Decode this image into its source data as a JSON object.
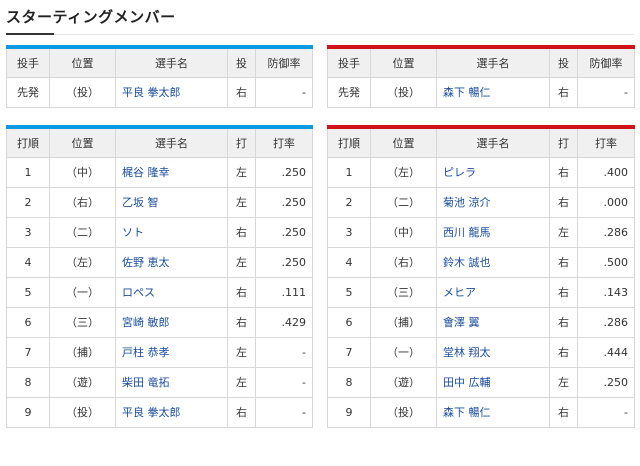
{
  "title": "スターティングメンバー",
  "colors": {
    "home_accent": "#0a9ae0",
    "away_accent": "#d0121b",
    "link": "#1a4d9e"
  },
  "pitcher_headers": [
    "投手",
    "位置",
    "選手名",
    "投",
    "防御率"
  ],
  "lineup_headers": [
    "打順",
    "位置",
    "選手名",
    "打",
    "打率"
  ],
  "home": {
    "pitcher": {
      "role": "先発",
      "pos": "（投）",
      "name": "平良 拳太郎",
      "throws": "右",
      "era": "-"
    },
    "lineup": [
      {
        "order": "1",
        "pos": "（中）",
        "name": "梶谷 隆幸",
        "bats": "左",
        "avg": ".250"
      },
      {
        "order": "2",
        "pos": "（右）",
        "name": "乙坂 智",
        "bats": "左",
        "avg": ".250"
      },
      {
        "order": "3",
        "pos": "（二）",
        "name": "ソト",
        "bats": "右",
        "avg": ".250"
      },
      {
        "order": "4",
        "pos": "（左）",
        "name": "佐野 恵太",
        "bats": "左",
        "avg": ".250"
      },
      {
        "order": "5",
        "pos": "（一）",
        "name": "ロペス",
        "bats": "右",
        "avg": ".111"
      },
      {
        "order": "6",
        "pos": "（三）",
        "name": "宮崎 敏郎",
        "bats": "右",
        "avg": ".429"
      },
      {
        "order": "7",
        "pos": "（捕）",
        "name": "戸柱 恭孝",
        "bats": "左",
        "avg": "-"
      },
      {
        "order": "8",
        "pos": "（遊）",
        "name": "柴田 竜拓",
        "bats": "左",
        "avg": "-"
      },
      {
        "order": "9",
        "pos": "（投）",
        "name": "平良 拳太郎",
        "bats": "右",
        "avg": "-"
      }
    ]
  },
  "away": {
    "pitcher": {
      "role": "先発",
      "pos": "（投）",
      "name": "森下 暢仁",
      "throws": "右",
      "era": "-"
    },
    "lineup": [
      {
        "order": "1",
        "pos": "（左）",
        "name": "ピレラ",
        "bats": "右",
        "avg": ".400"
      },
      {
        "order": "2",
        "pos": "（二）",
        "name": "菊池 涼介",
        "bats": "右",
        "avg": ".000"
      },
      {
        "order": "3",
        "pos": "（中）",
        "name": "西川 龍馬",
        "bats": "左",
        "avg": ".286"
      },
      {
        "order": "4",
        "pos": "（右）",
        "name": "鈴木 誠也",
        "bats": "右",
        "avg": ".500"
      },
      {
        "order": "5",
        "pos": "（三）",
        "name": "メヒア",
        "bats": "右",
        "avg": ".143"
      },
      {
        "order": "6",
        "pos": "（捕）",
        "name": "會澤 翼",
        "bats": "右",
        "avg": ".286"
      },
      {
        "order": "7",
        "pos": "（一）",
        "name": "堂林 翔太",
        "bats": "右",
        "avg": ".444"
      },
      {
        "order": "8",
        "pos": "（遊）",
        "name": "田中 広輔",
        "bats": "左",
        "avg": ".250"
      },
      {
        "order": "9",
        "pos": "（投）",
        "name": "森下 暢仁",
        "bats": "右",
        "avg": "-"
      }
    ]
  }
}
